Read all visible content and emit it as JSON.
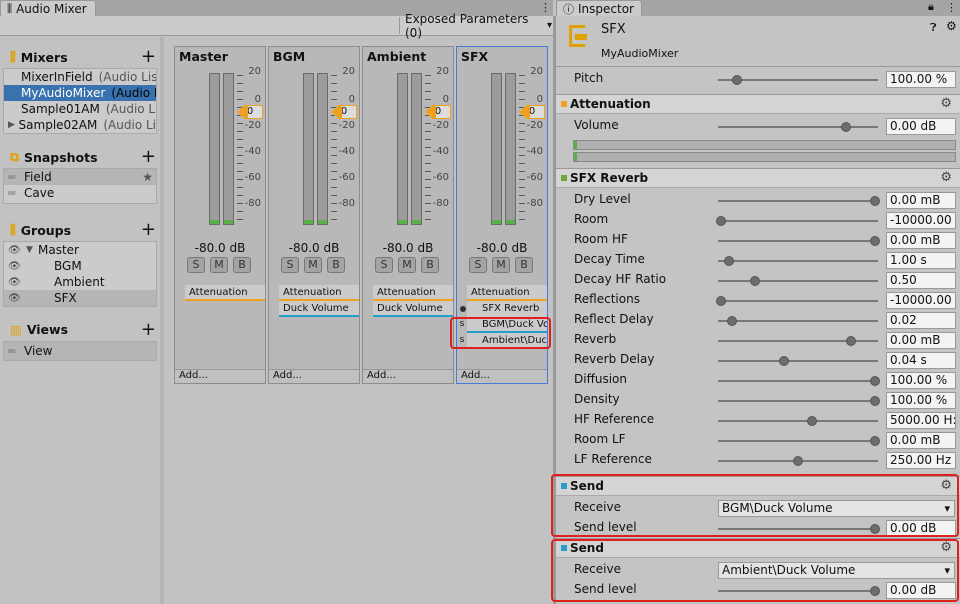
{
  "mixer_tab": {
    "title": "Audio Mixer"
  },
  "inspector_tab": {
    "title": "Inspector"
  },
  "toolbar": {
    "exposed_params": "Exposed Parameters (0)"
  },
  "mixers": {
    "title": "Mixers",
    "items": [
      {
        "name": "MixerInField",
        "sub": "(Audio Lis"
      },
      {
        "name": "MyAudioMixer",
        "sub": "(Audio L"
      },
      {
        "name": "Sample01AM",
        "sub": "(Audio Li"
      },
      {
        "name": "Sample02AM",
        "sub": "(Audio Li"
      }
    ]
  },
  "snapshots": {
    "title": "Snapshots",
    "items": [
      "Field",
      "Cave"
    ]
  },
  "groups": {
    "title": "Groups",
    "items": [
      "Master",
      "BGM",
      "Ambient",
      "SFX"
    ]
  },
  "views": {
    "title": "Views",
    "items": [
      "View"
    ]
  },
  "scale": [
    "20",
    "0",
    "-20",
    "-40",
    "-60",
    "-80"
  ],
  "strips": [
    {
      "name": "Master",
      "db": "-80.0 dB",
      "tag": "0",
      "effects": [
        "Attenuation"
      ],
      "add": "Add..."
    },
    {
      "name": "BGM",
      "db": "-80.0 dB",
      "tag": "0",
      "effects": [
        "Attenuation",
        "Duck Volume"
      ],
      "add": "Add..."
    },
    {
      "name": "Ambient",
      "db": "-80.0 dB",
      "tag": "0",
      "effects": [
        "Attenuation",
        "Duck Volume"
      ],
      "add": "Add..."
    },
    {
      "name": "SFX",
      "db": "-80.0 dB",
      "tag": "0",
      "effects": [
        "Attenuation",
        "SFX Reverb",
        "BGM\\Duck Vo",
        "Ambient\\Duc"
      ],
      "add": "Add..."
    }
  ],
  "smb": {
    "s": "S",
    "m": "M",
    "b": "B",
    "send": "s"
  },
  "inspector": {
    "name": "SFX",
    "mixer": "MyAudioMixer",
    "pitch": {
      "label": "Pitch",
      "value": "100.00 %",
      "level": 0.12
    },
    "attenuation": {
      "title": "Attenuation",
      "volume_label": "Volume",
      "volume": "0.00 dB",
      "level": 0.8
    },
    "reverb": {
      "title": "SFX Reverb",
      "params": [
        {
          "label": "Dry Level",
          "value": "0.00 mB",
          "level": 0.98
        },
        {
          "label": "Room",
          "value": "-10000.00",
          "level": 0.02
        },
        {
          "label": "Room HF",
          "value": "0.00 mB",
          "level": 0.98
        },
        {
          "label": "Decay Time",
          "value": "1.00 s",
          "level": 0.07
        },
        {
          "label": "Decay HF Ratio",
          "value": "0.50",
          "level": 0.23
        },
        {
          "label": "Reflections",
          "value": "-10000.00",
          "level": 0.02
        },
        {
          "label": "Reflect Delay",
          "value": "0.02",
          "level": 0.09
        },
        {
          "label": "Reverb",
          "value": "0.00 mB",
          "level": 0.83
        },
        {
          "label": "Reverb Delay",
          "value": "0.04 s",
          "level": 0.41
        },
        {
          "label": "Diffusion",
          "value": "100.00 %",
          "level": 0.98
        },
        {
          "label": "Density",
          "value": "100.00 %",
          "level": 0.98
        },
        {
          "label": "HF Reference",
          "value": "5000.00 H:",
          "level": 0.59
        },
        {
          "label": "Room LF",
          "value": "0.00 mB",
          "level": 0.98
        },
        {
          "label": "LF Reference",
          "value": "250.00 Hz",
          "level": 0.5
        }
      ]
    },
    "sends": [
      {
        "title": "Send",
        "receive_label": "Receive",
        "receive": "BGM\\Duck Volume",
        "level_label": "Send level",
        "level": "0.00 dB",
        "fill": 0.98
      },
      {
        "title": "Send",
        "receive_label": "Receive",
        "receive": "Ambient\\Duck Volume",
        "level_label": "Send level",
        "level": "0.00 dB",
        "fill": 0.98
      }
    ]
  },
  "colors": {
    "attenuation": "#f0a020",
    "reverb": "#6aa83a",
    "send": "#2a9cc8",
    "selection": "#3a72b0",
    "highlight": "#e02020"
  }
}
